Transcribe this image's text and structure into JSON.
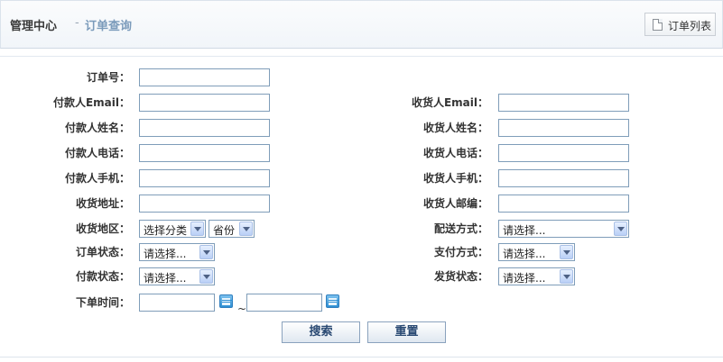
{
  "header": {
    "title": "管理中心",
    "separator": "-",
    "crumb": "订单查询",
    "list_button": "订单列表"
  },
  "labels": {
    "order_no": "订单号：",
    "payer_email": "付款人Email：",
    "payer_name": "付款人姓名：",
    "payer_phone": "付款人电话：",
    "payer_mobile": "付款人手机：",
    "shipping_address": "收货地址：",
    "shipping_region": "收货地区：",
    "order_status": "订单状态：",
    "pay_status": "付款状态：",
    "order_time": "下单时间：",
    "receiver_email": "收货人Email：",
    "receiver_name": "收货人姓名：",
    "receiver_phone": "收货人电话：",
    "receiver_mobile": "收货人手机：",
    "receiver_zip": "收货人邮编：",
    "delivery_method": "配送方式：",
    "payment_method": "支付方式：",
    "shipment_status": "发货状态："
  },
  "selects": {
    "region_category": "选择分类",
    "province": "省份",
    "delivery_method": "请选择...",
    "order_status": "请选择...",
    "payment_method": "请选择...",
    "pay_status": "请选择...",
    "shipment_status": "请选择..."
  },
  "date_separator": "~",
  "buttons": {
    "search": "搜索",
    "reset": "重置"
  }
}
